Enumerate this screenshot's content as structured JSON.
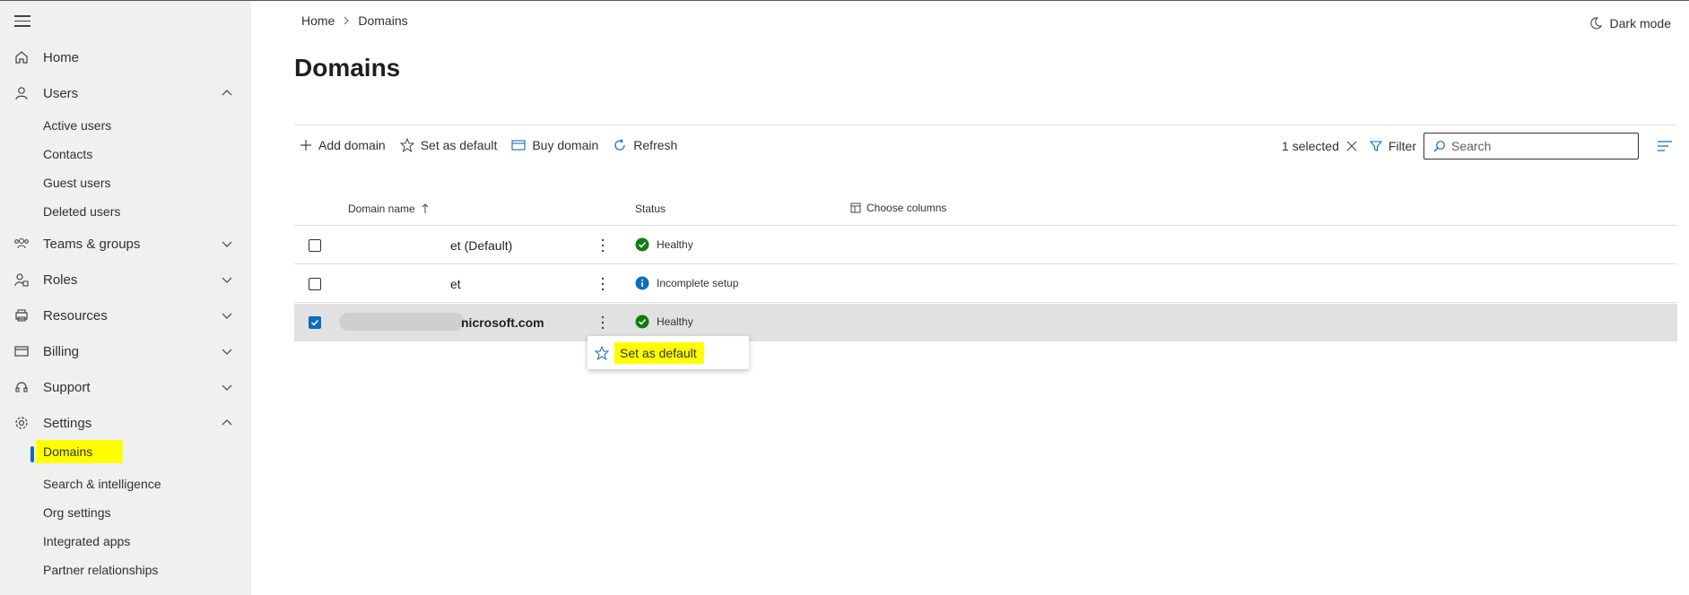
{
  "sidebar": {
    "home": "Home",
    "users": "Users",
    "users_sub": [
      "Active users",
      "Contacts",
      "Guest users",
      "Deleted users"
    ],
    "teams": "Teams & groups",
    "roles": "Roles",
    "resources": "Resources",
    "billing": "Billing",
    "support": "Support",
    "settings": "Settings",
    "settings_sub": [
      "Domains",
      "Search & intelligence",
      "Org settings",
      "Integrated apps",
      "Partner relationships"
    ]
  },
  "header": {
    "breadcrumb": [
      "Home",
      "Domains"
    ],
    "dark_mode": "Dark mode",
    "title": "Domains"
  },
  "toolbar": {
    "add_domain": "Add domain",
    "set_default": "Set as default",
    "buy_domain": "Buy domain",
    "refresh": "Refresh",
    "selected": "1 selected",
    "filter": "Filter",
    "search_placeholder": "Search"
  },
  "table": {
    "col_domain": "Domain name",
    "col_status": "Status",
    "choose_columns": "Choose columns",
    "rows": [
      {
        "domain": "et (Default)",
        "status": "Healthy",
        "status_type": "ok",
        "checked": false
      },
      {
        "domain": "et",
        "status": "Incomplete setup",
        "status_type": "info",
        "checked": false
      },
      {
        "domain": "nicrosoft.com",
        "status": "Healthy",
        "status_type": "ok",
        "checked": true
      }
    ]
  },
  "context_menu": {
    "set_default": "Set as default"
  },
  "colors": {
    "accent": "#0f6cbd",
    "healthy": "#107c10",
    "highlight": "#ffff00"
  }
}
